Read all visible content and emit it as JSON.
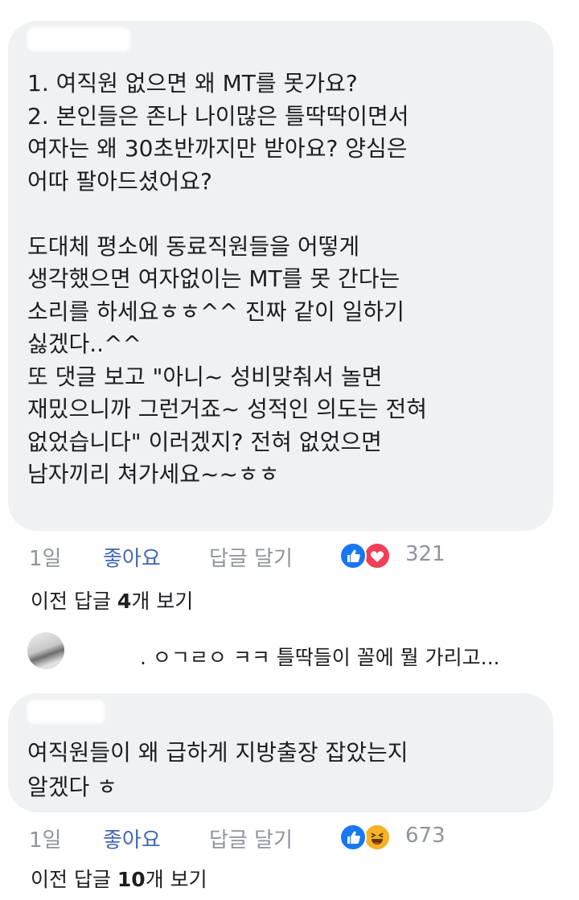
{
  "comments": [
    {
      "text": "1. 여직원 없으면 왜 MT를 못가요?\n2. 본인들은 존나 나이많은 틀딱딱이면서\n여자는 왜 30초반까지만 받아요? 양심은\n어따 팔아드셨어요?\n\n도대체 평소에 동료직원들을 어떻게\n생각했으면 여자없이는 MT를 못 간다는\n소리를 하세요ㅎㅎ^^ 진짜 같이 일하기\n싫겠다..^^\n또 댓글 보고 \"아니~ 성비맞춰서 놀면\n재밌으니까 그런거죠~ 성적인 의도는 전혀\n없었습니다\" 이러겠지? 전혀 없었으면\n남자끼리 쳐가세요~~ㅎㅎ",
      "time": "1일",
      "like_label": "좋아요",
      "reply_label": "답글 달기",
      "reactions": [
        "like-icon",
        "love-icon"
      ],
      "reaction_count": "321",
      "view_replies_prefix": "이전 답글 ",
      "view_replies_count": "4",
      "view_replies_suffix": "개 보기",
      "reply_preview": ". ㅇㄱㄹㅇ ㅋㅋ 틀딱들이 꼴에 뭘 가리고..."
    },
    {
      "text": "여직원들이 왜 급하게 지방출장 잡았는지\n알겠다 ㅎ",
      "time": "1일",
      "like_label": "좋아요",
      "reply_label": "답글 달기",
      "reactions": [
        "like-icon",
        "haha-icon"
      ],
      "reaction_count": "673",
      "view_replies_prefix": "이전 답글 ",
      "view_replies_count": "10",
      "view_replies_suffix": "개 보기"
    }
  ],
  "colors": {
    "bubble": "#f0f1f3",
    "link": "#4267b2",
    "meta": "#90949c",
    "like_reaction": "#1877f2",
    "love_reaction": "#f33e58",
    "haha_reaction": "#f7b125"
  }
}
